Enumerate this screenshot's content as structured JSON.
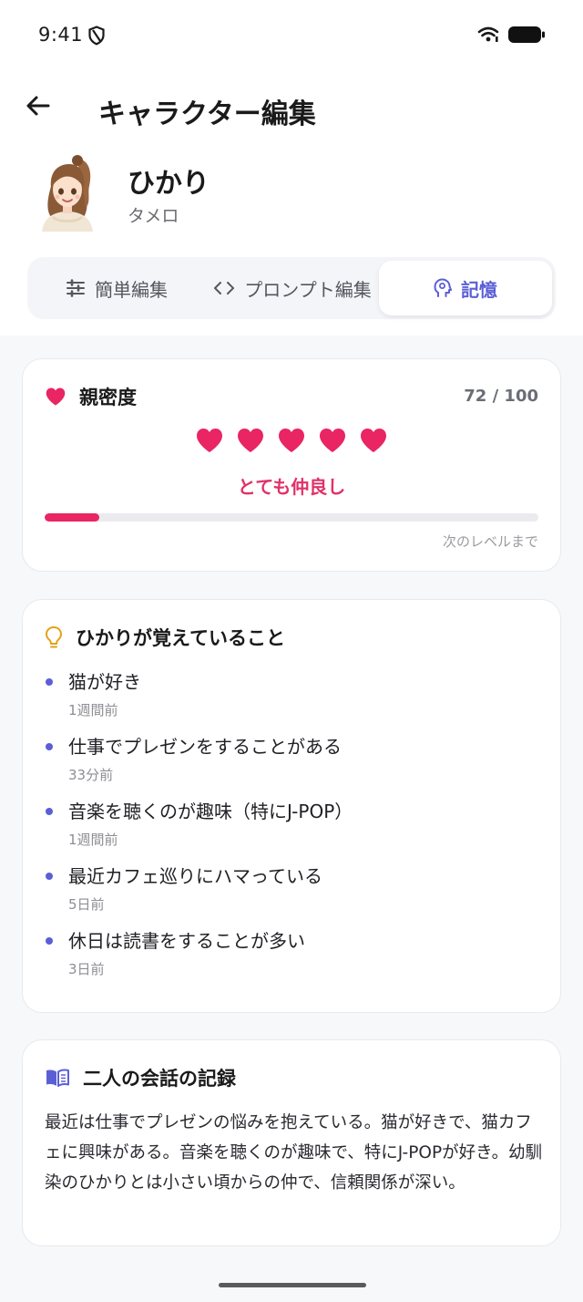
{
  "status_bar": {
    "time": "9:41"
  },
  "header": {
    "title": "キャラクター編集"
  },
  "profile": {
    "name": "ひかり",
    "subtitle": "タメロ"
  },
  "tabs": [
    {
      "label": "簡単編集",
      "icon": "sliders-icon",
      "active": false
    },
    {
      "label": "プロンプト編集",
      "icon": "code-icon",
      "active": false
    },
    {
      "label": "記憶",
      "icon": "brain-head-icon",
      "active": true
    }
  ],
  "affinity": {
    "title": "親密度",
    "score": "72 / 100",
    "hearts": 5,
    "level_label": "とても仲良し",
    "progress_fraction": 0.11,
    "next_level_label": "次のレベルまで",
    "accent_color": "#e92563"
  },
  "memories": {
    "title": "ひかりが覚えていること",
    "items": [
      {
        "text": "猫が好き",
        "time": "1週間前"
      },
      {
        "text": "仕事でプレゼンをすることがある",
        "time": "33分前"
      },
      {
        "text": "音楽を聴くのが趣味（特にJ-POP）",
        "time": "1週間前"
      },
      {
        "text": "最近カフェ巡りにハマっている",
        "time": "5日前"
      },
      {
        "text": "休日は読書をすることが多い",
        "time": "3日前"
      }
    ]
  },
  "conversation_log": {
    "title": "二人の会話の記録",
    "text": "最近は仕事でプレゼンの悩みを抱えている。猫が好きで、猫カフェに興味がある。音楽を聴くのが趣味で、特にJ-POPが好き。幼馴染のひかりとは小さい頃からの仲で、信頼関係が深い。"
  },
  "colors": {
    "accent": "#5b5fd6",
    "heart": "#e92563",
    "idea": "#e3a21a"
  }
}
